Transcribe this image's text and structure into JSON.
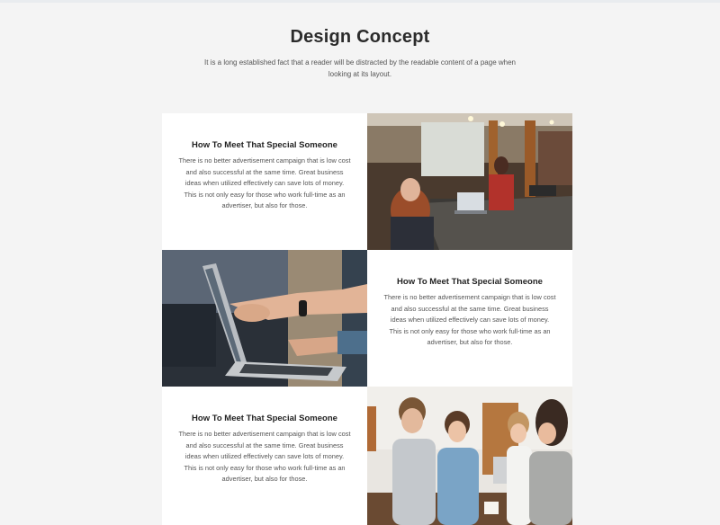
{
  "header": {
    "title": "Design Concept",
    "subtitle": "It is a long established fact that a reader will be distracted by the readable content of a page when looking at its layout."
  },
  "rows": [
    {
      "heading": "How To Meet That Special Someone",
      "body": "There is no better advertisement campaign that is low cost and also successful at the same time. Great business ideas when utilized effectively can save lots of money. This is not only easy for those who work full-time as an advertiser, but also for those."
    },
    {
      "heading": "How To Meet That Special Someone",
      "body": "There is no better advertisement campaign that is low cost and also successful at the same time. Great business ideas when utilized effectively can save lots of money. This is not only easy for those who work full-time as an advertiser, but also for those."
    },
    {
      "heading": "How To Meet That Special Someone",
      "body": "There is no better advertisement campaign that is low cost and also successful at the same time. Great business ideas when utilized effectively can save lots of money. This is not only easy for those who work full-time as an advertiser, but also for those."
    }
  ],
  "colors": {
    "background": "#f4f4f4",
    "card": "#ffffff",
    "heading": "#2b2b2b",
    "body_text": "#555555"
  }
}
